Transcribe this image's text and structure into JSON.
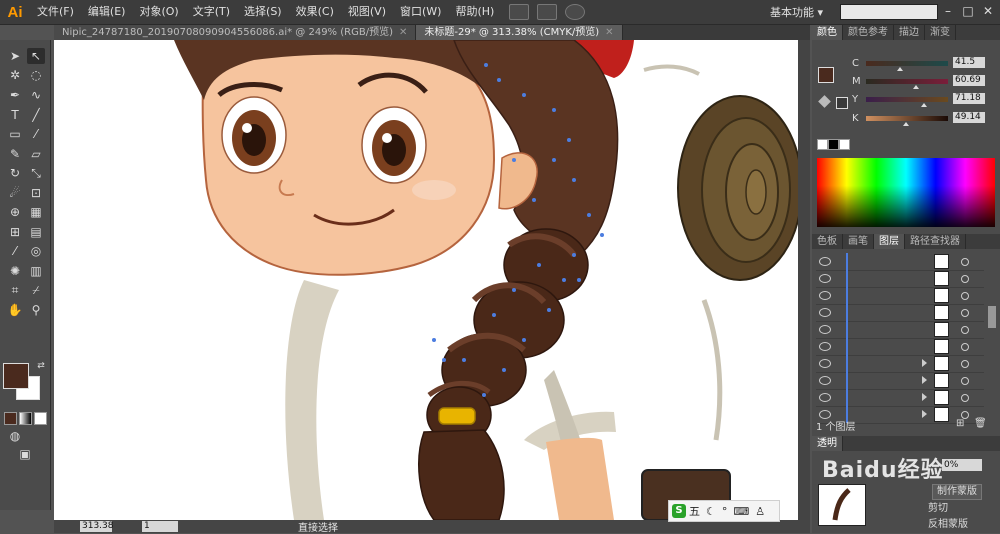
{
  "app": {
    "logo": "Ai",
    "menus": [
      "文件(F)",
      "编辑(E)",
      "对象(O)",
      "文字(T)",
      "选择(S)",
      "效果(C)",
      "视图(V)",
      "窗口(W)",
      "帮助(H)"
    ],
    "workspace_label": "基本功能",
    "search_placeholder": "",
    "colors": {
      "accent": "#ff9a00",
      "panel": "#4b4b4b",
      "selection": "#4c7de0"
    }
  },
  "doc_tabs": [
    {
      "title": "Nipic_24787180_20190708090904556086.ai* @ 249% (RGB/预览)",
      "close": "✕"
    },
    {
      "title": "未标题-29* @ 313.38% (CMYK/预览)",
      "close": "✕"
    }
  ],
  "status": {
    "zoom": "313.38",
    "page": "1",
    "tool_label": "直接选择"
  },
  "ime": {
    "logo": "S",
    "text": "五"
  },
  "color_panel": {
    "tabs": [
      "颜色",
      "颜色参考",
      "描边",
      "渐变"
    ],
    "sliders": [
      {
        "label": "C",
        "value": "41.5",
        "pos": 0.415
      },
      {
        "label": "M",
        "value": "60.69",
        "pos": 0.607
      },
      {
        "label": "Y",
        "value": "71.18",
        "pos": 0.712
      },
      {
        "label": "K",
        "value": "49.14",
        "pos": 0.491
      }
    ],
    "unit": "%",
    "current_color": "#4a2a1e"
  },
  "layers_panel": {
    "tabs": [
      "色板",
      "画笔",
      "图层",
      "路径查找器"
    ],
    "rows": 10,
    "footer_label": "1 个图层"
  },
  "transparency": {
    "tab_label": "透明",
    "opacity_value": "0%",
    "make_mask": "制作蒙版",
    "clip": "剪切",
    "invert": "反相蒙版"
  },
  "watermark": "Baidu经验"
}
